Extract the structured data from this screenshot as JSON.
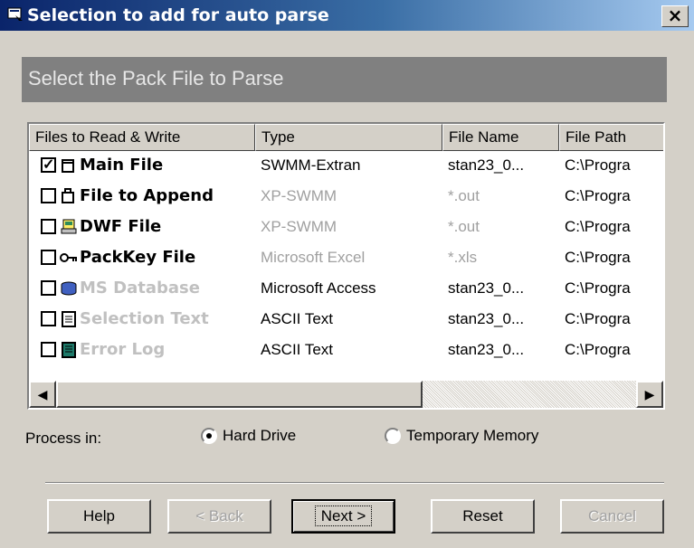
{
  "window": {
    "title": "Selection to add for auto parse",
    "close_label": "×"
  },
  "banner": {
    "text": "Select the Pack File to Parse"
  },
  "list": {
    "columns": [
      "Files to Read & Write",
      "Type",
      "File Name",
      "File Path"
    ],
    "rows": [
      {
        "checked": true,
        "icon": "document-icon",
        "name": "Main File",
        "name_disabled": false,
        "type": "SWMM-Extran",
        "type_disabled": false,
        "file_name": "stan23_0...",
        "file_name_disabled": false,
        "path": "C:\\Progra"
      },
      {
        "checked": false,
        "icon": "append-document-icon",
        "name": "File to Append",
        "name_disabled": false,
        "type": "XP-SWMM",
        "type_disabled": true,
        "file_name": "*.out",
        "file_name_disabled": true,
        "path": "C:\\Progra"
      },
      {
        "checked": false,
        "icon": "dwf-file-icon",
        "name": "DWF File",
        "name_disabled": false,
        "type": "XP-SWMM",
        "type_disabled": true,
        "file_name": "*.out",
        "file_name_disabled": true,
        "path": "C:\\Progra"
      },
      {
        "checked": false,
        "icon": "key-icon",
        "name": "PackKey File",
        "name_disabled": false,
        "type": "Microsoft Excel",
        "type_disabled": true,
        "file_name": "*.xls",
        "file_name_disabled": true,
        "path": "C:\\Progra"
      },
      {
        "checked": false,
        "icon": "database-icon",
        "name": "MS Database",
        "name_disabled": true,
        "type": "Microsoft Access",
        "type_disabled": false,
        "file_name": "stan23_0...",
        "file_name_disabled": false,
        "path": "C:\\Progra"
      },
      {
        "checked": false,
        "icon": "notepad-icon",
        "name": "Selection Text",
        "name_disabled": true,
        "type": "ASCII Text",
        "type_disabled": false,
        "file_name": "stan23_0...",
        "file_name_disabled": false,
        "path": "C:\\Progra"
      },
      {
        "checked": false,
        "icon": "log-book-icon",
        "name": "Error Log",
        "name_disabled": true,
        "type": "ASCII Text",
        "type_disabled": false,
        "file_name": "stan23_0...",
        "file_name_disabled": false,
        "path": "C:\\Progra"
      }
    ]
  },
  "process": {
    "label": "Process in:",
    "options": [
      {
        "label": "Hard Drive",
        "selected": true
      },
      {
        "label": "Temporary Memory",
        "selected": false
      }
    ]
  },
  "buttons": {
    "help": "Help",
    "back": "< Back",
    "next": "Next >",
    "reset": "Reset",
    "cancel": "Cancel"
  },
  "colors": {
    "title_bar": "#0a246a",
    "face": "#d4d0c8",
    "banner": "#808080",
    "disabled_text": "#a0a0a0"
  }
}
